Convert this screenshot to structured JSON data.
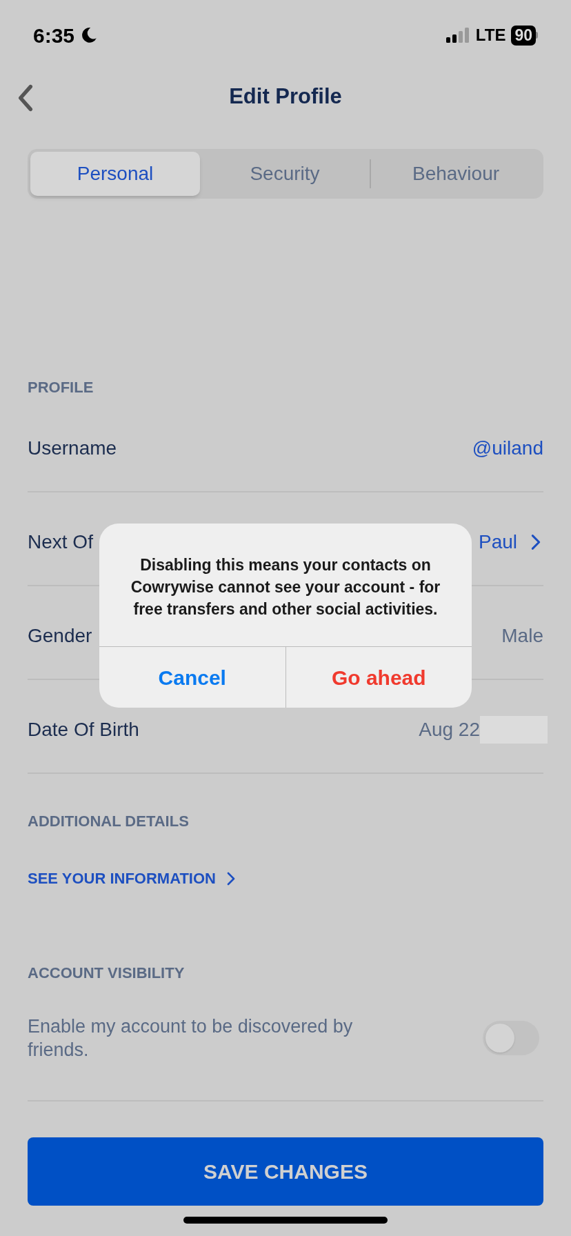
{
  "status_bar": {
    "time": "6:35",
    "network": "LTE",
    "battery": "90"
  },
  "header": {
    "title": "Edit Profile"
  },
  "tabs": [
    {
      "label": "Personal",
      "selected": true
    },
    {
      "label": "Security",
      "selected": false
    },
    {
      "label": "Behaviour",
      "selected": false
    }
  ],
  "profile": {
    "title": "PROFILE",
    "rows": [
      {
        "label": "Username",
        "value": "@uiland",
        "kind": "accent"
      },
      {
        "label": "Next Of",
        "value": "Paul",
        "kind": "nav"
      },
      {
        "label": "Gender",
        "value": "Male",
        "kind": "muted"
      },
      {
        "label": "Date Of Birth",
        "value": "Aug 22",
        "kind": "redacted"
      }
    ]
  },
  "additional": {
    "title": "ADDITIONAL DETAILS",
    "link": "SEE YOUR INFORMATION"
  },
  "visibility": {
    "title": "ACCOUNT VISIBILITY",
    "text": "Enable my account to be discovered by friends.",
    "on": false
  },
  "save_button": "SAVE CHANGES",
  "dialog": {
    "message": "Disabling this means your contacts on Cowrywise cannot see your account - for free transfers and other social activities.",
    "buttons": [
      {
        "label": "Cancel",
        "kind": "cancel"
      },
      {
        "label": "Go ahead",
        "kind": "destructive"
      }
    ]
  }
}
